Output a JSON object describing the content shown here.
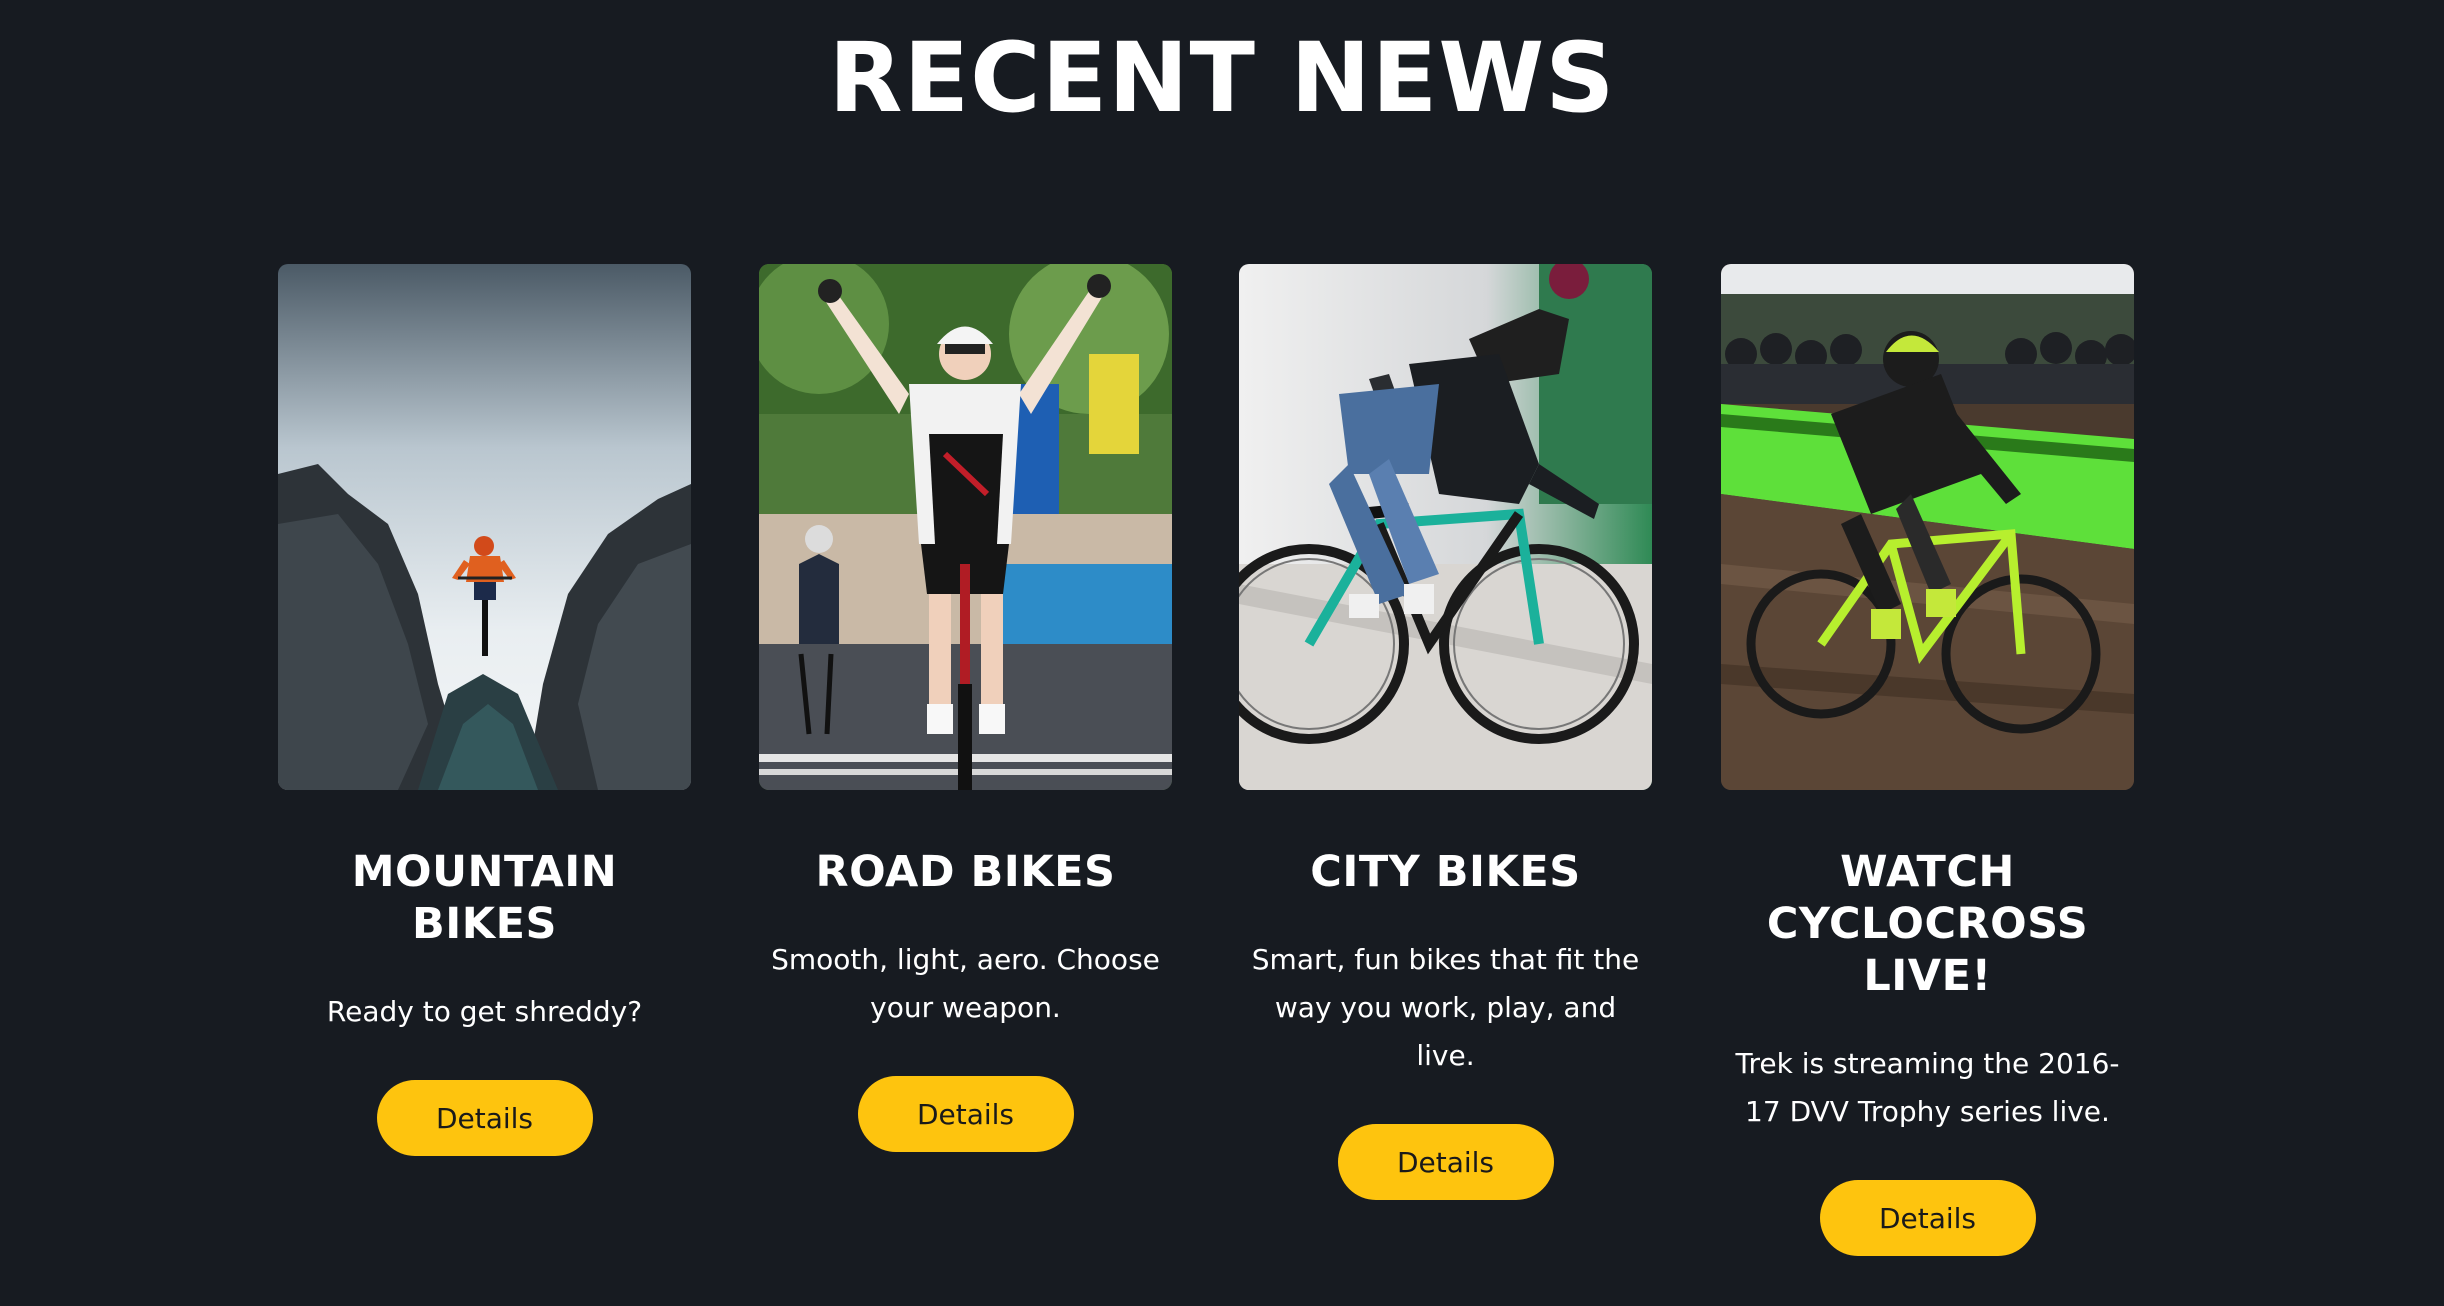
{
  "section": {
    "title": "RECENT NEWS"
  },
  "colors": {
    "background": "#171b21",
    "accent": "#fec40e",
    "text": "#ffffff",
    "button_text": "#1a1a1a"
  },
  "cards": [
    {
      "title": "MOUNTAIN BIKES",
      "description": "Ready to get shreddy?",
      "button_label": "Details",
      "image": "mountain-bike-rider-photo"
    },
    {
      "title": "ROAD BIKES",
      "description": "Smooth, light, aero. Choose your weapon.",
      "button_label": "Details",
      "image": "road-race-winner-photo"
    },
    {
      "title": "CITY BIKES",
      "description": "Smart, fun bikes that fit the way you work, play, and live.",
      "button_label": "Details",
      "image": "city-bike-rider-photo"
    },
    {
      "title": "WATCH CYCLOCROSS LIVE!",
      "description": "Trek is streaming the 2016-17 DVV Trophy series live.",
      "button_label": "Details",
      "image": "cyclocross-race-photo"
    }
  ]
}
